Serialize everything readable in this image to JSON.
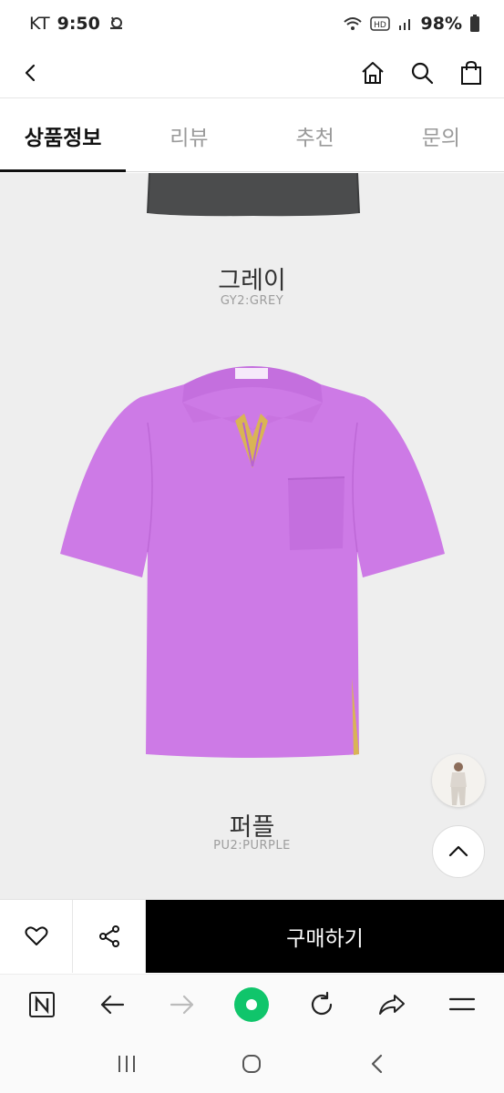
{
  "status_bar": {
    "carrier": "KT",
    "time": "9:50",
    "battery": "98%",
    "icons": [
      "snail-notification-icon",
      "wifi-icon",
      "hd-voice-icon",
      "signal-icon",
      "battery-icon"
    ]
  },
  "header": {
    "icons": [
      "back-arrow-icon",
      "home-icon",
      "search-icon",
      "shopping-bag-icon"
    ]
  },
  "tabs": [
    {
      "label": "상품정보",
      "active": true
    },
    {
      "label": "리뷰",
      "active": false
    },
    {
      "label": "추천",
      "active": false
    },
    {
      "label": "문의",
      "active": false
    }
  ],
  "colors": [
    {
      "name": "그레이",
      "code": "GY2:GREY"
    },
    {
      "name": "퍼플",
      "code": "PU2:PURPLE"
    }
  ],
  "palette": {
    "accent_black": "#000000",
    "content_bg": "#eeeeee",
    "grey_shirt": "#4b4c4d",
    "purple_shirt": "#cd7ae6",
    "placket_yellow": "#d9b455",
    "browser_green": "#10c56b"
  },
  "purchase_bar": {
    "wishlist_icon": "heart-icon",
    "share_icon": "share-icon",
    "buy_label": "구매하기"
  },
  "browser_toolbar": {
    "icons": [
      "naver-n-icon",
      "back-arrow-icon",
      "forward-arrow-icon",
      "green-dot-home-icon",
      "reload-icon",
      "share-forward-icon",
      "menu-icon"
    ]
  },
  "system_nav": {
    "icons": [
      "recent-apps-icon",
      "home-circle-icon",
      "back-chevron-icon"
    ]
  }
}
